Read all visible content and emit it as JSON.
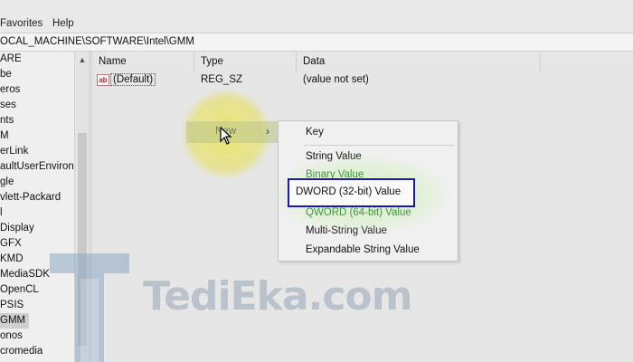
{
  "menubar": {
    "items": [
      "Favorites",
      "Help"
    ]
  },
  "address": {
    "path": "OCAL_MACHINE\\SOFTWARE\\Intel\\GMM"
  },
  "tree": {
    "items": [
      "ARE",
      "be",
      "eros",
      "ses",
      "nts",
      "M",
      "erLink",
      "aultUserEnvironn",
      "gle",
      "vlett-Packard",
      "l",
      "Display",
      "GFX",
      "KMD",
      "MediaSDK",
      "OpenCL",
      "PSIS",
      "GMM",
      "onos",
      "cromedia"
    ],
    "selected": "GMM"
  },
  "columns": {
    "name": "Name",
    "type": "Type",
    "data": "Data"
  },
  "rows": [
    {
      "icon": "ab",
      "name": "(Default)",
      "type": "REG_SZ",
      "data": "(value not set)"
    }
  ],
  "context_menu": {
    "new_label": "New",
    "arrow": "›"
  },
  "submenu": {
    "key": "Key",
    "string_value": "String Value",
    "binary_value": "Binary Value",
    "dword_value": "DWORD (32-bit) Value",
    "qword_value": "QWORD (64-bit) Value",
    "multi_string_value": "Multi-String Value",
    "expandable_string_value": "Expandable String Value"
  },
  "watermark": {
    "text": "TediEka.com"
  },
  "colors": {
    "highlight_box": "#1a1ab0",
    "cursor_glow": "#ebe66e",
    "selection_glow": "#bee9a0"
  },
  "icons": {
    "tree_scroll_up": "chevron-up-icon",
    "submenu_arrow": "chevron-right-icon",
    "cursor": "mouse-pointer-icon",
    "string_value": "ab-string-icon"
  }
}
